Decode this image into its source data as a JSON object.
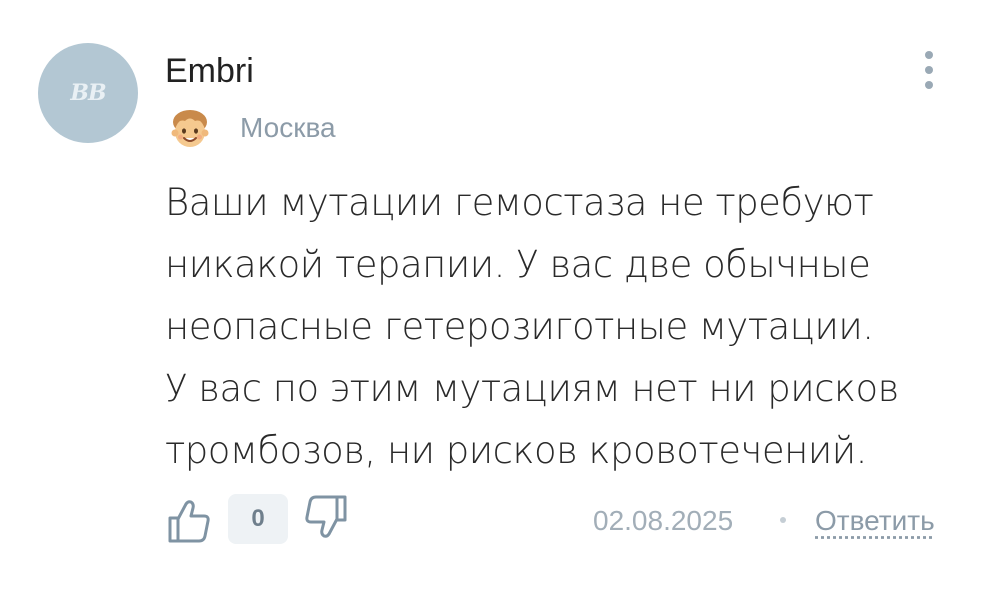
{
  "comment": {
    "avatar_initials": "BB",
    "author": "Embri",
    "badge_icon": "smiling-face-icon",
    "city": "Москва",
    "text": "Ваши мутации гемостаза не требуют никакой терапии. У вас две обычные неопасные гетерозиготные мутации. У вас по этим мутациям нет ни рисков тромбозов, ни рисков кровотечений.",
    "rating": "0",
    "date": "02.08.2025",
    "reply_label": "Ответить"
  },
  "icons": {
    "more": "vertical-dots-icon",
    "like": "thumbs-up-icon",
    "dislike": "thumbs-down-icon"
  },
  "colors": {
    "avatar_bg": "#b3c7d3",
    "icon_stroke": "#7f93a3",
    "secondary_text": "#8c9ba8",
    "main_text": "#2a2a2a"
  }
}
